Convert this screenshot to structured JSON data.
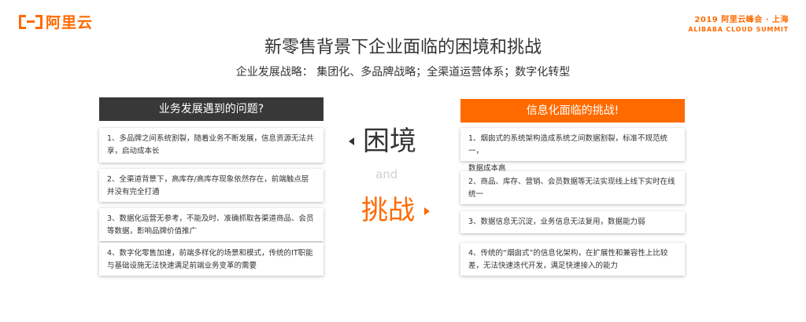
{
  "brand": {
    "logo_text": "阿里云",
    "accent_color": "#ff6a00",
    "summit_line1": "2019 阿里云峰会 · 上海",
    "summit_line2": "ALIBABA CLOUD SUMMIT"
  },
  "slide": {
    "title": "新零售背景下企业面临的困境和挑战",
    "subtitle": "企业发展战略： 集团化、多品牌战略；全渠道运营体系；数字化转型"
  },
  "left_panel": {
    "header": "业务发展遇到的问题?",
    "items": [
      "1、多品牌之间系统割裂，随着业务不断发展，信息资源无法共享，启动成本长",
      "2、全渠道背景下，高库存/高库存现象依然存在，前端触点层并没有完全打通",
      "3、数据化运营无参考，不能及时、准确抓取各渠道商品、会员等数据，影响品牌价值推广",
      "4、数字化零售加速，前端多样化的场景和模式，传统的IT职能与基础设施无法快速满足前端业务变革的需要"
    ]
  },
  "right_panel": {
    "header": "信息化面临的挑战!",
    "items": [
      "1、烟囱式的系统架构造成系统之间数据割裂，标准不规范统一，",
      "2、商品、库存、营销、会员数据等无法实现线上线下实时在线统一",
      "3、数据信息无沉淀，业务信息无法复用，数据能力弱",
      "4、传统的“烟囱式”的信息化架构，在扩展性和兼容性上比较差，无法快速迭代开发，满足快速接入的能力"
    ],
    "extra_note": "数据成本高"
  },
  "center": {
    "word_dilemma": "困境",
    "word_and": "and",
    "word_challenge": "挑战"
  }
}
